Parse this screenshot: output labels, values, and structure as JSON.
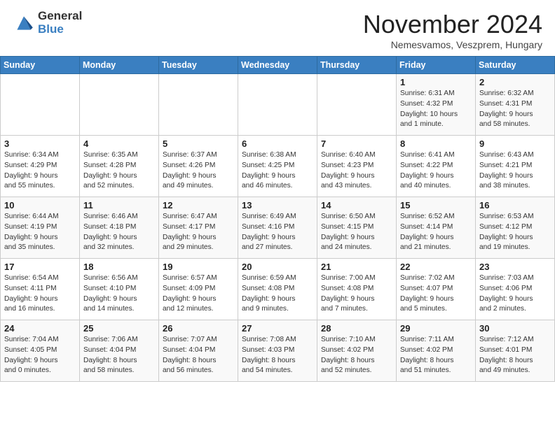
{
  "header": {
    "logo_general": "General",
    "logo_blue": "Blue",
    "month_title": "November 2024",
    "location": "Nemesvamos, Veszprem, Hungary"
  },
  "days_of_week": [
    "Sunday",
    "Monday",
    "Tuesday",
    "Wednesday",
    "Thursday",
    "Friday",
    "Saturday"
  ],
  "weeks": [
    [
      {
        "day": "",
        "info": ""
      },
      {
        "day": "",
        "info": ""
      },
      {
        "day": "",
        "info": ""
      },
      {
        "day": "",
        "info": ""
      },
      {
        "day": "",
        "info": ""
      },
      {
        "day": "1",
        "info": "Sunrise: 6:31 AM\nSunset: 4:32 PM\nDaylight: 10 hours\nand 1 minute."
      },
      {
        "day": "2",
        "info": "Sunrise: 6:32 AM\nSunset: 4:31 PM\nDaylight: 9 hours\nand 58 minutes."
      }
    ],
    [
      {
        "day": "3",
        "info": "Sunrise: 6:34 AM\nSunset: 4:29 PM\nDaylight: 9 hours\nand 55 minutes."
      },
      {
        "day": "4",
        "info": "Sunrise: 6:35 AM\nSunset: 4:28 PM\nDaylight: 9 hours\nand 52 minutes."
      },
      {
        "day": "5",
        "info": "Sunrise: 6:37 AM\nSunset: 4:26 PM\nDaylight: 9 hours\nand 49 minutes."
      },
      {
        "day": "6",
        "info": "Sunrise: 6:38 AM\nSunset: 4:25 PM\nDaylight: 9 hours\nand 46 minutes."
      },
      {
        "day": "7",
        "info": "Sunrise: 6:40 AM\nSunset: 4:23 PM\nDaylight: 9 hours\nand 43 minutes."
      },
      {
        "day": "8",
        "info": "Sunrise: 6:41 AM\nSunset: 4:22 PM\nDaylight: 9 hours\nand 40 minutes."
      },
      {
        "day": "9",
        "info": "Sunrise: 6:43 AM\nSunset: 4:21 PM\nDaylight: 9 hours\nand 38 minutes."
      }
    ],
    [
      {
        "day": "10",
        "info": "Sunrise: 6:44 AM\nSunset: 4:19 PM\nDaylight: 9 hours\nand 35 minutes."
      },
      {
        "day": "11",
        "info": "Sunrise: 6:46 AM\nSunset: 4:18 PM\nDaylight: 9 hours\nand 32 minutes."
      },
      {
        "day": "12",
        "info": "Sunrise: 6:47 AM\nSunset: 4:17 PM\nDaylight: 9 hours\nand 29 minutes."
      },
      {
        "day": "13",
        "info": "Sunrise: 6:49 AM\nSunset: 4:16 PM\nDaylight: 9 hours\nand 27 minutes."
      },
      {
        "day": "14",
        "info": "Sunrise: 6:50 AM\nSunset: 4:15 PM\nDaylight: 9 hours\nand 24 minutes."
      },
      {
        "day": "15",
        "info": "Sunrise: 6:52 AM\nSunset: 4:14 PM\nDaylight: 9 hours\nand 21 minutes."
      },
      {
        "day": "16",
        "info": "Sunrise: 6:53 AM\nSunset: 4:12 PM\nDaylight: 9 hours\nand 19 minutes."
      }
    ],
    [
      {
        "day": "17",
        "info": "Sunrise: 6:54 AM\nSunset: 4:11 PM\nDaylight: 9 hours\nand 16 minutes."
      },
      {
        "day": "18",
        "info": "Sunrise: 6:56 AM\nSunset: 4:10 PM\nDaylight: 9 hours\nand 14 minutes."
      },
      {
        "day": "19",
        "info": "Sunrise: 6:57 AM\nSunset: 4:09 PM\nDaylight: 9 hours\nand 12 minutes."
      },
      {
        "day": "20",
        "info": "Sunrise: 6:59 AM\nSunset: 4:08 PM\nDaylight: 9 hours\nand 9 minutes."
      },
      {
        "day": "21",
        "info": "Sunrise: 7:00 AM\nSunset: 4:08 PM\nDaylight: 9 hours\nand 7 minutes."
      },
      {
        "day": "22",
        "info": "Sunrise: 7:02 AM\nSunset: 4:07 PM\nDaylight: 9 hours\nand 5 minutes."
      },
      {
        "day": "23",
        "info": "Sunrise: 7:03 AM\nSunset: 4:06 PM\nDaylight: 9 hours\nand 2 minutes."
      }
    ],
    [
      {
        "day": "24",
        "info": "Sunrise: 7:04 AM\nSunset: 4:05 PM\nDaylight: 9 hours\nand 0 minutes."
      },
      {
        "day": "25",
        "info": "Sunrise: 7:06 AM\nSunset: 4:04 PM\nDaylight: 8 hours\nand 58 minutes."
      },
      {
        "day": "26",
        "info": "Sunrise: 7:07 AM\nSunset: 4:04 PM\nDaylight: 8 hours\nand 56 minutes."
      },
      {
        "day": "27",
        "info": "Sunrise: 7:08 AM\nSunset: 4:03 PM\nDaylight: 8 hours\nand 54 minutes."
      },
      {
        "day": "28",
        "info": "Sunrise: 7:10 AM\nSunset: 4:02 PM\nDaylight: 8 hours\nand 52 minutes."
      },
      {
        "day": "29",
        "info": "Sunrise: 7:11 AM\nSunset: 4:02 PM\nDaylight: 8 hours\nand 51 minutes."
      },
      {
        "day": "30",
        "info": "Sunrise: 7:12 AM\nSunset: 4:01 PM\nDaylight: 8 hours\nand 49 minutes."
      }
    ]
  ]
}
